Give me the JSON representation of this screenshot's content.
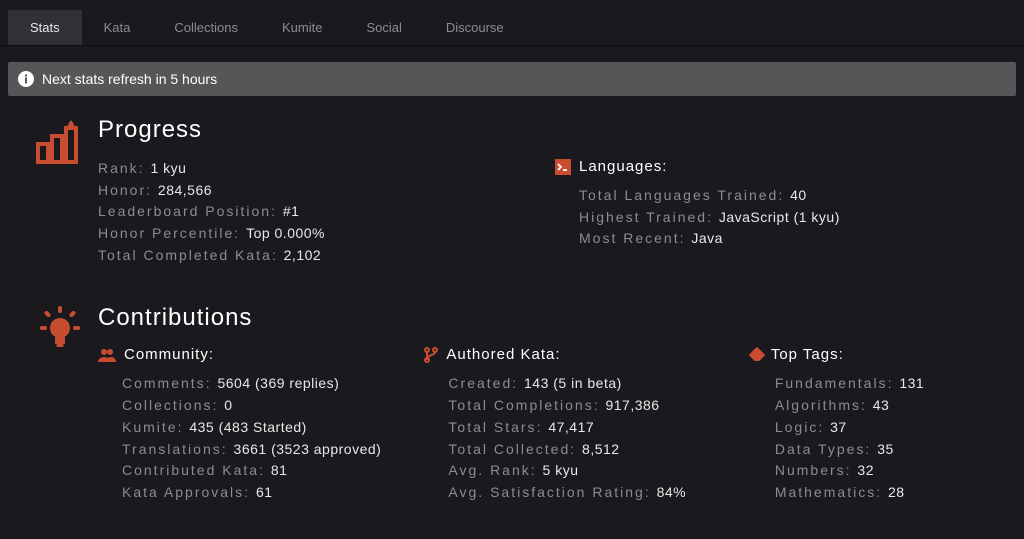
{
  "tabs": [
    {
      "label": "Stats",
      "active": true
    },
    {
      "label": "Kata",
      "active": false
    },
    {
      "label": "Collections",
      "active": false
    },
    {
      "label": "Kumite",
      "active": false
    },
    {
      "label": "Social",
      "active": false
    },
    {
      "label": "Discourse",
      "active": false
    }
  ],
  "banner": {
    "text": "Next stats refresh in 5 hours"
  },
  "progress": {
    "title": "Progress",
    "stats": {
      "rank": {
        "label": "Rank",
        "value": "1 kyu"
      },
      "honor": {
        "label": "Honor",
        "value": "284,566"
      },
      "leaderboard": {
        "label": "Leaderboard Position",
        "value": "#1"
      },
      "percentile": {
        "label": "Honor Percentile",
        "value": "Top 0.000%"
      },
      "completed": {
        "label": "Total Completed Kata",
        "value": "2,102"
      }
    },
    "languages": {
      "header": "Languages:",
      "total": {
        "label": "Total Languages Trained",
        "value": "40"
      },
      "highest": {
        "label": "Highest Trained",
        "value": "JavaScript (1 kyu)"
      },
      "recent": {
        "label": "Most Recent",
        "value": "Java"
      }
    }
  },
  "contrib": {
    "title": "Contributions",
    "community": {
      "header": "Community:",
      "comments": {
        "label": "Comments",
        "value": "5604 (369 replies)"
      },
      "collections": {
        "label": "Collections",
        "value": "0"
      },
      "kumite": {
        "label": "Kumite",
        "value": "435 (483 Started)"
      },
      "translations": {
        "label": "Translations",
        "value": "3661 (3523 approved)"
      },
      "contributed": {
        "label": "Contributed Kata",
        "value": "81"
      },
      "approvals": {
        "label": "Kata Approvals",
        "value": "61"
      }
    },
    "authored": {
      "header": "Authored Kata:",
      "created": {
        "label": "Created",
        "value": "143 (5 in beta)"
      },
      "completions": {
        "label": "Total Completions",
        "value": "917,386"
      },
      "stars": {
        "label": "Total Stars",
        "value": "47,417"
      },
      "collected": {
        "label": "Total Collected",
        "value": "8,512"
      },
      "avgrank": {
        "label": "Avg. Rank",
        "value": "5 kyu"
      },
      "satisfaction": {
        "label": "Avg. Satisfaction Rating",
        "value": "84%"
      }
    },
    "tags": {
      "header": "Top Tags:",
      "items": [
        {
          "label": "Fundamentals",
          "value": "131"
        },
        {
          "label": "Algorithms",
          "value": "43"
        },
        {
          "label": "Logic",
          "value": "37"
        },
        {
          "label": "Data Types",
          "value": "35"
        },
        {
          "label": "Numbers",
          "value": "32"
        },
        {
          "label": "Mathematics",
          "value": "28"
        }
      ]
    }
  }
}
